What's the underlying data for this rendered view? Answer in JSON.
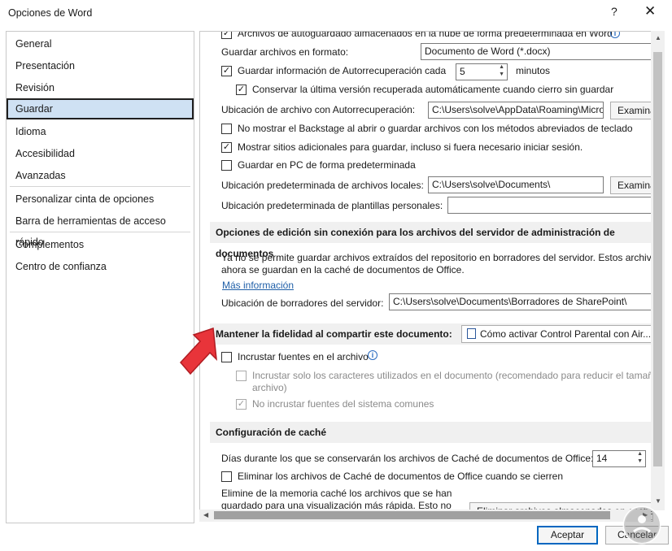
{
  "window": {
    "title": "Opciones de Word",
    "help": "?",
    "close": "✕"
  },
  "sidebar": {
    "items": [
      {
        "label": "General"
      },
      {
        "label": "Presentación"
      },
      {
        "label": "Revisión"
      },
      {
        "label": "Guardar",
        "active": true
      },
      {
        "label": "Idioma"
      },
      {
        "label": "Accesibilidad"
      },
      {
        "label": "Avanzadas"
      },
      {
        "label": "Personalizar cinta de opciones"
      },
      {
        "label": "Barra de herramientas de acceso rápido"
      },
      {
        "label": "Complementos"
      },
      {
        "label": "Centro de confianza"
      }
    ]
  },
  "save": {
    "cloud_autosave_label": "Archivos de autoguardado almacenados en la nube de forma predeterminada en Word",
    "format_label": "Guardar archivos en formato:",
    "format_value": "Documento de Word (*.docx)",
    "autorecover_label": "Guardar información de Autorrecuperación cada",
    "autorecover_minutes": "5",
    "minutes_label": "minutos",
    "keep_last_label": "Conservar la última versión recuperada automáticamente cuando cierro sin guardar",
    "autorecover_location_label": "Ubicación de archivo con Autorrecuperación:",
    "autorecover_location_value": "C:\\Users\\solve\\AppData\\Roaming\\Micro",
    "browse_label": "Examinar...",
    "no_backstage_label": "No mostrar el Backstage al abrir o guardar archivos con los métodos abreviados de teclado",
    "show_more_places_label": "Mostrar sitios adicionales para guardar, incluso si fuera necesario iniciar sesión.",
    "save_to_pc_label": "Guardar en PC de forma predeterminada",
    "local_files_label": "Ubicación predeterminada de archivos locales:",
    "local_files_value": "C:\\Users\\solve\\Documents\\",
    "browse2_label": "Examinar...",
    "templates_label": "Ubicación predeterminada de plantillas personales:",
    "templates_value": ""
  },
  "offline": {
    "header": "Opciones de edición sin conexión para los archivos del servidor de administración de documentos",
    "desc_line1": "Ya no se permite guardar archivos extraídos del repositorio en borradores del servidor. Estos archivos",
    "desc_line2": "ahora se guardan en la caché de documentos de Office.",
    "more_info": "Más información",
    "drafts_label": "Ubicación de borradores del servidor:",
    "drafts_value": "C:\\Users\\solve\\Documents\\Borradores de SharePoint\\"
  },
  "fidelity": {
    "header": "Mantener la fidelidad al compartir este documento:",
    "document_value": "Cómo activar Control Parental con Air...",
    "embed_fonts_label": "Incrustar fuentes en el archivo",
    "embed_used_label": "Incrustar solo los caracteres utilizados en el documento (recomendado para reducir el tamaño del",
    "embed_used_label_2": "archivo)",
    "no_common_label": "No incrustar fuentes del sistema comunes"
  },
  "cache": {
    "header": "Configuración de caché",
    "days_label": "Días durante los que se conservarán los archivos de Caché de documentos de Office:",
    "days_value": "14",
    "delete_label": "Eliminar los archivos de Caché de documentos de Office cuando se cierren",
    "clear_line1": "Elimine de la memoria caché los archivos que se han",
    "clear_line2": "guardado para una visualización más rápida. Esto no",
    "clear_button": "Eliminar archivos almacenados en caché"
  },
  "footer": {
    "ok": "Aceptar",
    "cancel": "Cancelar"
  },
  "icons": {
    "pointer": "red-arrow-icon",
    "watermark": "logo-icon"
  },
  "colors": {
    "accent": "#0067c0",
    "pointer": "#e8343a",
    "active_bg": "#cfe1f3"
  }
}
